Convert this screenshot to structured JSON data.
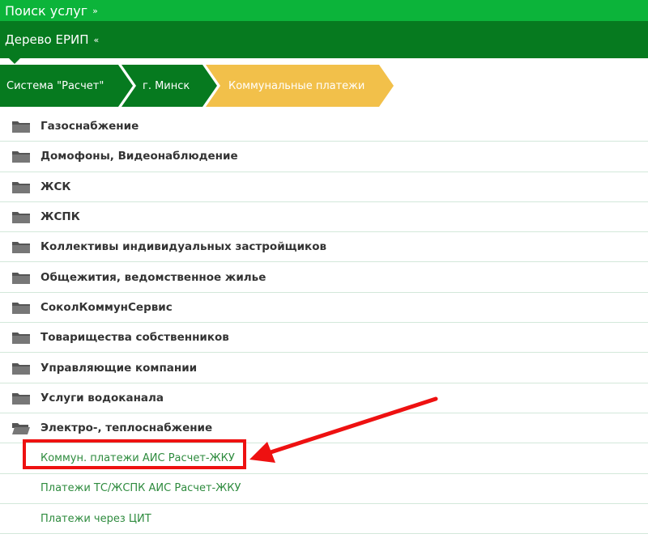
{
  "search_bar": {
    "label": "Поиск услуг",
    "chevron": "»"
  },
  "tree_bar": {
    "label": "Дерево ЕРИП",
    "chevron": "«"
  },
  "breadcrumb": [
    {
      "label": "Система \"Расчет\""
    },
    {
      "label": "г. Минск"
    },
    {
      "label": "Коммунальные платежи"
    }
  ],
  "categories": [
    {
      "label": "Газоснабжение",
      "icon": "folder-icon"
    },
    {
      "label": "Домофоны, Видеонаблюдение",
      "icon": "folder-icon"
    },
    {
      "label": "ЖСК",
      "icon": "folder-icon"
    },
    {
      "label": "ЖСПК",
      "icon": "folder-icon"
    },
    {
      "label": "Коллективы индивидуальных застройщиков",
      "icon": "folder-icon"
    },
    {
      "label": "Общежития, ведомственное жилье",
      "icon": "folder-icon"
    },
    {
      "label": "СоколКоммунСервис",
      "icon": "folder-icon"
    },
    {
      "label": "Товарищества собственников",
      "icon": "folder-icon"
    },
    {
      "label": "Управляющие компании",
      "icon": "folder-icon"
    },
    {
      "label": "Услуги водоканала",
      "icon": "folder-icon"
    },
    {
      "label": "Электро-, теплоснабжение",
      "icon": "open-folder-icon"
    }
  ],
  "services": [
    {
      "label": "Коммун. платежи АИС Расчет-ЖКУ"
    },
    {
      "label": "Платежи ТС/ЖСПК АИС Расчет-ЖКУ"
    },
    {
      "label": "Платежи через ЦИТ"
    }
  ],
  "colors": {
    "search_bar": "#0cb43a",
    "tree_bar": "#067a1f",
    "breadcrumb_dark": "#067a1f",
    "breadcrumb_active": "#f2c04a",
    "link": "#2e8b3e",
    "annotation": "#ee1111"
  }
}
